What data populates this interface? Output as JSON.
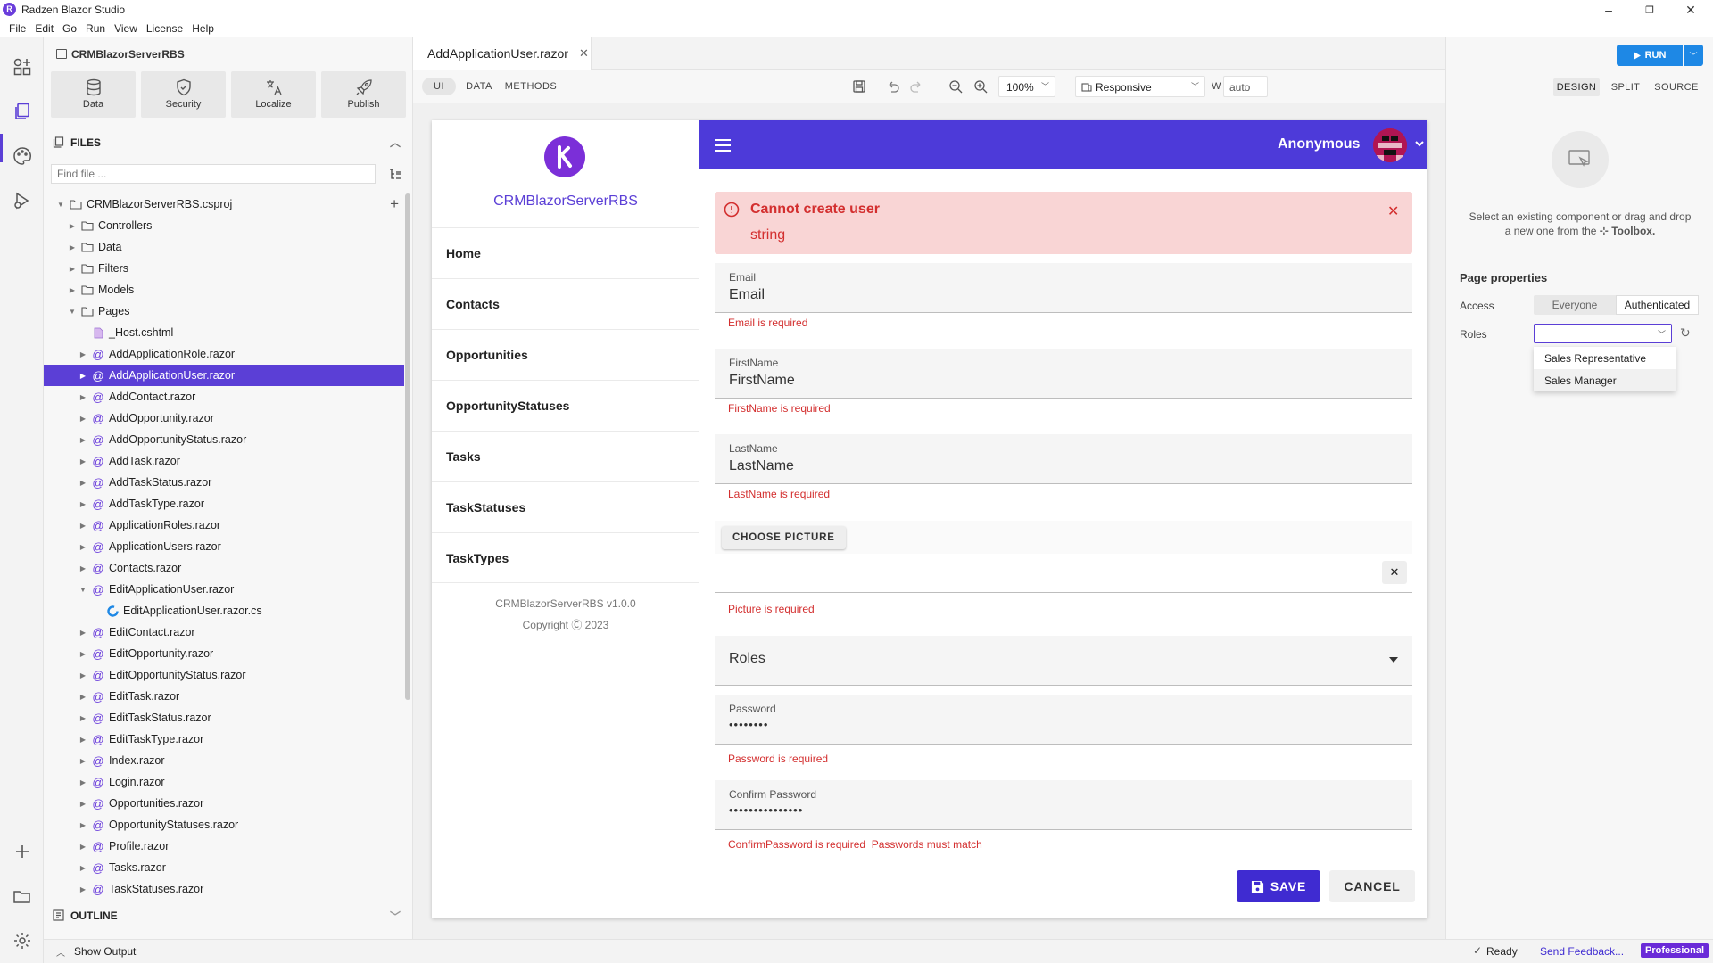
{
  "window": {
    "title": "Radzen Blazor Studio",
    "logo_letter": "R",
    "controls": {
      "minimize": "–",
      "restore": "❐",
      "close": "✕"
    }
  },
  "menu": [
    "File",
    "Edit",
    "Go",
    "Run",
    "View",
    "License",
    "Help"
  ],
  "sidebar": {
    "project": "CRMBlazorServerRBS",
    "tools": [
      {
        "label": "Data",
        "icon": "database-icon"
      },
      {
        "label": "Security",
        "icon": "shield-icon"
      },
      {
        "label": "Localize",
        "icon": "translate-icon"
      },
      {
        "label": "Publish",
        "icon": "rocket-icon"
      }
    ],
    "files_title": "FILES",
    "find_placeholder": "Find file ...",
    "outline_title": "OUTLINE",
    "tree": [
      {
        "label": "CRMBlazorServerRBS.csproj",
        "depth": 0,
        "type": "folder",
        "chevron": "open"
      },
      {
        "label": "Controllers",
        "depth": 1,
        "type": "folder",
        "chevron": "closed"
      },
      {
        "label": "Data",
        "depth": 1,
        "type": "folder",
        "chevron": "closed"
      },
      {
        "label": "Filters",
        "depth": 1,
        "type": "folder",
        "chevron": "closed"
      },
      {
        "label": "Models",
        "depth": 1,
        "type": "folder",
        "chevron": "closed"
      },
      {
        "label": "Pages",
        "depth": 1,
        "type": "folder",
        "chevron": "open"
      },
      {
        "label": "_Host.cshtml",
        "depth": 2,
        "type": "file",
        "chevron": "none"
      },
      {
        "label": "AddApplicationRole.razor",
        "depth": 2,
        "type": "razor",
        "chevron": "closed"
      },
      {
        "label": "AddApplicationUser.razor",
        "depth": 2,
        "type": "razor",
        "chevron": "closed",
        "selected": true
      },
      {
        "label": "AddContact.razor",
        "depth": 2,
        "type": "razor",
        "chevron": "closed"
      },
      {
        "label": "AddOpportunity.razor",
        "depth": 2,
        "type": "razor",
        "chevron": "closed"
      },
      {
        "label": "AddOpportunityStatus.razor",
        "depth": 2,
        "type": "razor",
        "chevron": "closed"
      },
      {
        "label": "AddTask.razor",
        "depth": 2,
        "type": "razor",
        "chevron": "closed"
      },
      {
        "label": "AddTaskStatus.razor",
        "depth": 2,
        "type": "razor",
        "chevron": "closed"
      },
      {
        "label": "AddTaskType.razor",
        "depth": 2,
        "type": "razor",
        "chevron": "closed"
      },
      {
        "label": "ApplicationRoles.razor",
        "depth": 2,
        "type": "razor",
        "chevron": "closed"
      },
      {
        "label": "ApplicationUsers.razor",
        "depth": 2,
        "type": "razor",
        "chevron": "closed"
      },
      {
        "label": "Contacts.razor",
        "depth": 2,
        "type": "razor",
        "chevron": "closed"
      },
      {
        "label": "EditApplicationUser.razor",
        "depth": 2,
        "type": "razor",
        "chevron": "open"
      },
      {
        "label": "EditApplicationUser.razor.cs",
        "depth": 3,
        "type": "cs",
        "chevron": "none"
      },
      {
        "label": "EditContact.razor",
        "depth": 2,
        "type": "razor",
        "chevron": "closed"
      },
      {
        "label": "EditOpportunity.razor",
        "depth": 2,
        "type": "razor",
        "chevron": "closed"
      },
      {
        "label": "EditOpportunityStatus.razor",
        "depth": 2,
        "type": "razor",
        "chevron": "closed"
      },
      {
        "label": "EditTask.razor",
        "depth": 2,
        "type": "razor",
        "chevron": "closed"
      },
      {
        "label": "EditTaskStatus.razor",
        "depth": 2,
        "type": "razor",
        "chevron": "closed"
      },
      {
        "label": "EditTaskType.razor",
        "depth": 2,
        "type": "razor",
        "chevron": "closed"
      },
      {
        "label": "Index.razor",
        "depth": 2,
        "type": "razor",
        "chevron": "closed"
      },
      {
        "label": "Login.razor",
        "depth": 2,
        "type": "razor",
        "chevron": "closed"
      },
      {
        "label": "Opportunities.razor",
        "depth": 2,
        "type": "razor",
        "chevron": "closed"
      },
      {
        "label": "OpportunityStatuses.razor",
        "depth": 2,
        "type": "razor",
        "chevron": "closed"
      },
      {
        "label": "Profile.razor",
        "depth": 2,
        "type": "razor",
        "chevron": "closed"
      },
      {
        "label": "Tasks.razor",
        "depth": 2,
        "type": "razor",
        "chevron": "closed"
      },
      {
        "label": "TaskStatuses.razor",
        "depth": 2,
        "type": "razor",
        "chevron": "closed"
      }
    ]
  },
  "editor": {
    "tab": "AddApplicationUser.razor",
    "modes": [
      "UI",
      "DATA",
      "METHODS"
    ],
    "zoom": "100%",
    "layout": "Responsive",
    "width_label": "W",
    "width_value": "auto",
    "views": [
      "DESIGN",
      "SPLIT",
      "SOURCE"
    ],
    "run_label": "RUN"
  },
  "preview": {
    "app_name": "CRMBlazorServerRBS",
    "nav": [
      "Home",
      "Contacts",
      "Opportunities",
      "OpportunityStatuses",
      "Tasks",
      "TaskStatuses",
      "TaskTypes"
    ],
    "version": "CRMBlazorServerRBS v1.0.0",
    "copyright": "Copyright Ⓒ 2023",
    "user": "Anonymous",
    "alert_title": "Cannot create user",
    "alert_message": "string",
    "fields": {
      "email": {
        "label": "Email",
        "placeholder": "Email",
        "error": "Email is required"
      },
      "firstname": {
        "label": "FirstName",
        "placeholder": "FirstName",
        "error": "FirstName is required"
      },
      "lastname": {
        "label": "LastName",
        "placeholder": "LastName",
        "error": "LastName is required"
      },
      "picture": {
        "button": "CHOOSE PICTURE",
        "error": "Picture is required"
      },
      "roles": {
        "placeholder": "Roles"
      },
      "password": {
        "label": "Password",
        "value": "••••••••",
        "error": "Password is required"
      },
      "confirm": {
        "label": "Confirm Password",
        "value": "•••••••••••••••",
        "error": "ConfirmPassword is required",
        "error2": "Passwords must match"
      }
    },
    "save": "SAVE",
    "cancel": "CANCEL"
  },
  "properties": {
    "empty_hint_1": "Select an existing component or drag and drop",
    "empty_hint_2": "a new one from the",
    "toolbox": "Toolbox.",
    "title": "Page properties",
    "access_label": "Access",
    "access_options": [
      "Everyone",
      "Authenticated"
    ],
    "roles_label": "Roles",
    "roles_options": [
      "Sales Representative",
      "Sales Manager"
    ]
  },
  "status": {
    "output": "Show Output",
    "ready": "Ready",
    "feedback": "Send Feedback...",
    "edition": "Professional"
  },
  "colors": {
    "accent": "#5b3fd6",
    "header": "#4d3ad9",
    "run": "#1e88e5",
    "error": "#d32f2f",
    "alert_bg": "#f9d5d5"
  }
}
